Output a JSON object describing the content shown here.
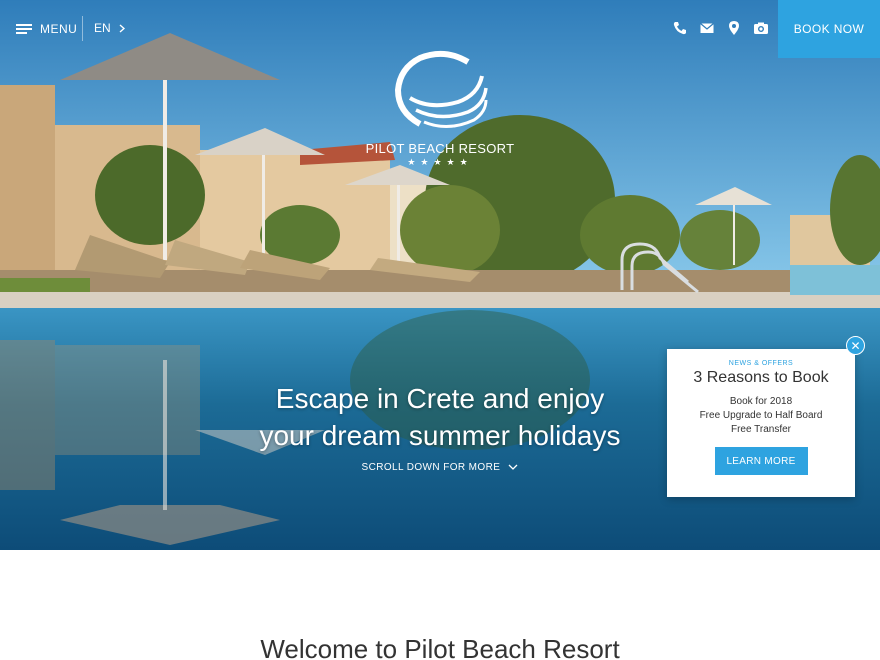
{
  "header": {
    "menu_label": "MENU",
    "lang_label": "EN",
    "book_now_label": "BOOK NOW",
    "icons": [
      "phone-icon",
      "mail-icon",
      "location-pin-icon",
      "camera-icon"
    ]
  },
  "logo": {
    "name": "PILOT BEACH RESORT",
    "stars": "★★★★★"
  },
  "hero": {
    "headline_line1": "Escape in Crete and enjoy",
    "headline_line2": "your dream summer holidays",
    "scroll_label": "SCROLL DOWN FOR MORE"
  },
  "offer": {
    "tag": "NEWS & OFFERS",
    "title": "3 Reasons to Book",
    "lines": [
      "Book for 2018",
      "Free Upgrade to Half Board",
      "Free Transfer"
    ],
    "button_label": "LEARN MORE",
    "close_symbol": "✕"
  },
  "welcome": {
    "title": "Welcome to Pilot Beach Resort"
  },
  "colors": {
    "accent": "#2ea3e0",
    "text_dark": "#333333"
  }
}
